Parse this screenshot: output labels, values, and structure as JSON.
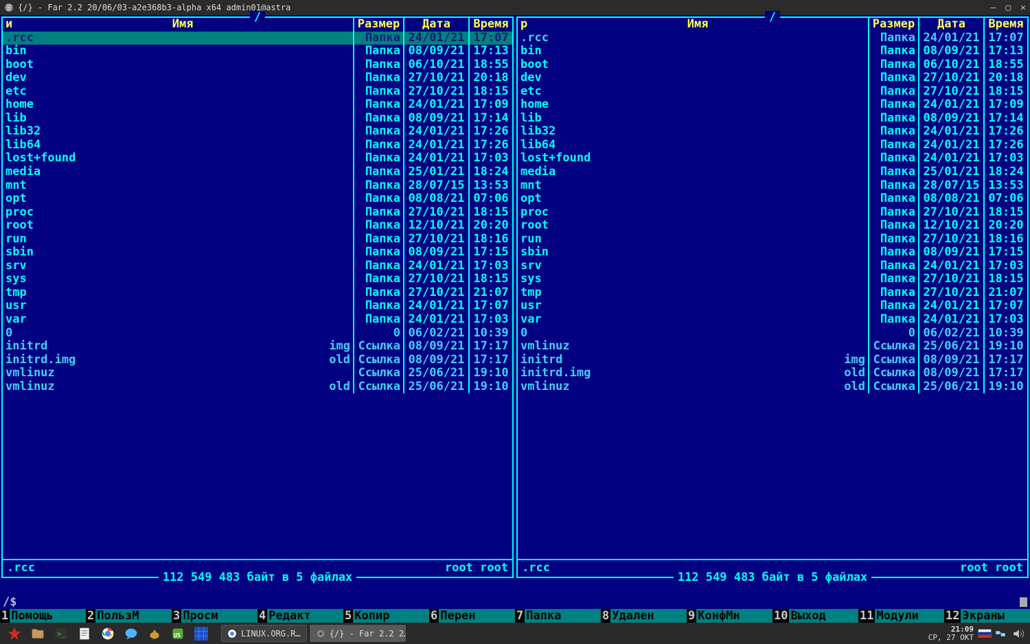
{
  "window": {
    "title": "{/} - Far 2.2 20/06/03-a2e368b3-alpha x64 admin01@astra"
  },
  "colors": {
    "panel_bg": "#000080",
    "border": "#00ffff",
    "header": "#ffff55",
    "text": "#00ffff",
    "sel_bg": "#008080"
  },
  "panel_headers": {
    "sort_left": "и",
    "sort_right": "р",
    "name": "Имя",
    "size": "Размер",
    "date": "Дата",
    "time": "Время"
  },
  "panel_path": "/",
  "left_panel": {
    "footer_name": ".rcc",
    "footer_right": "root   root",
    "status": "112 549 483 байт в 5 файлах",
    "items": [
      {
        "name": ".rcc",
        "ext": "",
        "size": "Папка",
        "date": "24/01/21",
        "time": "17:07",
        "sel": true
      },
      {
        "name": "bin",
        "ext": "",
        "size": "Папка",
        "date": "08/09/21",
        "time": "17:13"
      },
      {
        "name": "boot",
        "ext": "",
        "size": "Папка",
        "date": "06/10/21",
        "time": "18:55"
      },
      {
        "name": "dev",
        "ext": "",
        "size": "Папка",
        "date": "27/10/21",
        "time": "20:18"
      },
      {
        "name": "etc",
        "ext": "",
        "size": "Папка",
        "date": "27/10/21",
        "time": "18:15"
      },
      {
        "name": "home",
        "ext": "",
        "size": "Папка",
        "date": "24/01/21",
        "time": "17:09"
      },
      {
        "name": "lib",
        "ext": "",
        "size": "Папка",
        "date": "08/09/21",
        "time": "17:14"
      },
      {
        "name": "lib32",
        "ext": "",
        "size": "Папка",
        "date": "24/01/21",
        "time": "17:26"
      },
      {
        "name": "lib64",
        "ext": "",
        "size": "Папка",
        "date": "24/01/21",
        "time": "17:26"
      },
      {
        "name": "lost+found",
        "ext": "",
        "size": "Папка",
        "date": "24/01/21",
        "time": "17:03"
      },
      {
        "name": "media",
        "ext": "",
        "size": "Папка",
        "date": "25/01/21",
        "time": "18:24"
      },
      {
        "name": "mnt",
        "ext": "",
        "size": "Папка",
        "date": "28/07/15",
        "time": "13:53"
      },
      {
        "name": "opt",
        "ext": "",
        "size": "Папка",
        "date": "08/08/21",
        "time": "07:06"
      },
      {
        "name": "proc",
        "ext": "",
        "size": "Папка",
        "date": "27/10/21",
        "time": "18:15"
      },
      {
        "name": "root",
        "ext": "",
        "size": "Папка",
        "date": "12/10/21",
        "time": "20:20"
      },
      {
        "name": "run",
        "ext": "",
        "size": "Папка",
        "date": "27/10/21",
        "time": "18:16"
      },
      {
        "name": "sbin",
        "ext": "",
        "size": "Папка",
        "date": "08/09/21",
        "time": "17:15"
      },
      {
        "name": "srv",
        "ext": "",
        "size": "Папка",
        "date": "24/01/21",
        "time": "17:03"
      },
      {
        "name": "sys",
        "ext": "",
        "size": "Папка",
        "date": "27/10/21",
        "time": "18:15"
      },
      {
        "name": "tmp",
        "ext": "",
        "size": "Папка",
        "date": "27/10/21",
        "time": "21:07"
      },
      {
        "name": "usr",
        "ext": "",
        "size": "Папка",
        "date": "24/01/21",
        "time": "17:07"
      },
      {
        "name": "var",
        "ext": "",
        "size": "Папка",
        "date": "24/01/21",
        "time": "17:03"
      },
      {
        "name": "0",
        "ext": "",
        "size": "0",
        "date": "06/02/21",
        "time": "10:39",
        "cls": "other"
      },
      {
        "name": "initrd",
        "ext": "img",
        "size": "Ссылка",
        "date": "08/09/21",
        "time": "17:17",
        "cls": "other"
      },
      {
        "name": "initrd.img",
        "ext": "old",
        "size": "Ссылка",
        "date": "08/09/21",
        "time": "17:17",
        "cls": "other"
      },
      {
        "name": "vmlinuz",
        "ext": "",
        "size": "Ссылка",
        "date": "25/06/21",
        "time": "19:10",
        "cls": "other"
      },
      {
        "name": "vmlinuz",
        "ext": "old",
        "size": "Ссылка",
        "date": "25/06/21",
        "time": "19:10",
        "cls": "other"
      }
    ]
  },
  "right_panel": {
    "footer_name": ".rcc",
    "footer_right": "root   root",
    "status": "112 549 483 байт в 5 файлах",
    "items": [
      {
        "name": ".rcc",
        "ext": "",
        "size": "Папка",
        "date": "24/01/21",
        "time": "17:07",
        "cls": "other"
      },
      {
        "name": "bin",
        "ext": "",
        "size": "Папка",
        "date": "08/09/21",
        "time": "17:13"
      },
      {
        "name": "boot",
        "ext": "",
        "size": "Папка",
        "date": "06/10/21",
        "time": "18:55"
      },
      {
        "name": "dev",
        "ext": "",
        "size": "Папка",
        "date": "27/10/21",
        "time": "20:18"
      },
      {
        "name": "etc",
        "ext": "",
        "size": "Папка",
        "date": "27/10/21",
        "time": "18:15"
      },
      {
        "name": "home",
        "ext": "",
        "size": "Папка",
        "date": "24/01/21",
        "time": "17:09"
      },
      {
        "name": "lib",
        "ext": "",
        "size": "Папка",
        "date": "08/09/21",
        "time": "17:14"
      },
      {
        "name": "lib32",
        "ext": "",
        "size": "Папка",
        "date": "24/01/21",
        "time": "17:26"
      },
      {
        "name": "lib64",
        "ext": "",
        "size": "Папка",
        "date": "24/01/21",
        "time": "17:26"
      },
      {
        "name": "lost+found",
        "ext": "",
        "size": "Папка",
        "date": "24/01/21",
        "time": "17:03"
      },
      {
        "name": "media",
        "ext": "",
        "size": "Папка",
        "date": "25/01/21",
        "time": "18:24"
      },
      {
        "name": "mnt",
        "ext": "",
        "size": "Папка",
        "date": "28/07/15",
        "time": "13:53"
      },
      {
        "name": "opt",
        "ext": "",
        "size": "Папка",
        "date": "08/08/21",
        "time": "07:06"
      },
      {
        "name": "proc",
        "ext": "",
        "size": "Папка",
        "date": "27/10/21",
        "time": "18:15"
      },
      {
        "name": "root",
        "ext": "",
        "size": "Папка",
        "date": "12/10/21",
        "time": "20:20"
      },
      {
        "name": "run",
        "ext": "",
        "size": "Папка",
        "date": "27/10/21",
        "time": "18:16"
      },
      {
        "name": "sbin",
        "ext": "",
        "size": "Папка",
        "date": "08/09/21",
        "time": "17:15"
      },
      {
        "name": "srv",
        "ext": "",
        "size": "Папка",
        "date": "24/01/21",
        "time": "17:03"
      },
      {
        "name": "sys",
        "ext": "",
        "size": "Папка",
        "date": "27/10/21",
        "time": "18:15"
      },
      {
        "name": "tmp",
        "ext": "",
        "size": "Папка",
        "date": "27/10/21",
        "time": "21:07"
      },
      {
        "name": "usr",
        "ext": "",
        "size": "Папка",
        "date": "24/01/21",
        "time": "17:07"
      },
      {
        "name": "var",
        "ext": "",
        "size": "Папка",
        "date": "24/01/21",
        "time": "17:03"
      },
      {
        "name": "0",
        "ext": "",
        "size": "0",
        "date": "06/02/21",
        "time": "10:39",
        "cls": "other"
      },
      {
        "name": "vmlinuz",
        "ext": "",
        "size": "Ссылка",
        "date": "25/06/21",
        "time": "19:10",
        "cls": "other"
      },
      {
        "name": "initrd",
        "ext": "img",
        "size": "Ссылка",
        "date": "08/09/21",
        "time": "17:17",
        "cls": "other"
      },
      {
        "name": "initrd.img",
        "ext": "old",
        "size": "Ссылка",
        "date": "08/09/21",
        "time": "17:17",
        "cls": "other"
      },
      {
        "name": "vmlinuz",
        "ext": "old",
        "size": "Ссылка",
        "date": "25/06/21",
        "time": "19:10",
        "cls": "other"
      }
    ]
  },
  "cmdline": {
    "prompt": "/$"
  },
  "keybar": [
    {
      "n": "1",
      "l": "Помощь"
    },
    {
      "n": "2",
      "l": "ПользМ"
    },
    {
      "n": "3",
      "l": "Просм"
    },
    {
      "n": "4",
      "l": "Редакт"
    },
    {
      "n": "5",
      "l": "Копир"
    },
    {
      "n": "6",
      "l": "Перен"
    },
    {
      "n": "7",
      "l": "Папка"
    },
    {
      "n": "8",
      "l": "Удален"
    },
    {
      "n": "9",
      "l": "КонфМн"
    },
    {
      "n": "10",
      "l": "Выход"
    },
    {
      "n": "11",
      "l": "Модули"
    },
    {
      "n": "12",
      "l": "Экраны"
    }
  ],
  "taskbar": {
    "tasks": [
      {
        "label": "LINUX.ORG.R…",
        "active": false,
        "icon": "chrome"
      },
      {
        "label": "{/} - Far 2.2 2…",
        "active": true,
        "icon": "gear"
      }
    ],
    "clock_time": "21:09",
    "clock_date": "СР, 27 ОКТ"
  }
}
